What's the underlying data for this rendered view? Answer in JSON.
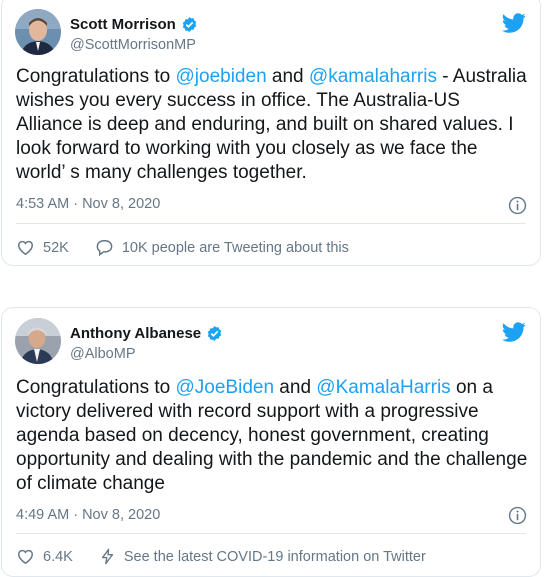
{
  "tweets": [
    {
      "name": "Scott Morrison",
      "handle": "@ScottMorrisonMP",
      "text_a": "Congratulations to ",
      "mention1": "@joebiden",
      "text_b": " and ",
      "mention2": "@kamalaharris",
      "text_c": " - Australia wishes you every success in office. The Australia-US Alliance is deep and enduring, and built on shared values. I look forward to working with you closely as we face the world’  s many challenges together.",
      "time": "4:53 AM · Nov 8, 2020",
      "likes": "52K",
      "secondary": "10K people are Tweeting about this",
      "secondary_icon": "speech-bubble-icon"
    },
    {
      "name": "Anthony Albanese",
      "handle": "@AlboMP",
      "text_a": "Congratulations to ",
      "mention1": "@JoeBiden",
      "text_b": " and ",
      "mention2": "@KamalaHarris",
      "text_c": " on a victory delivered with record support with a progressive agenda based on decency, honest government, creating opportunity and dealing with the pandemic and the challenge of climate change",
      "time": "4:49 AM · Nov 8, 2020",
      "likes": "6.4K",
      "secondary": "See the latest COVID-19 information on Twitter",
      "secondary_icon": "lightning-icon"
    }
  ],
  "colors": {
    "accent": "#1da1f2",
    "verified": "#1da1f2",
    "muted": "#657786",
    "border": "#e1e8ed"
  }
}
